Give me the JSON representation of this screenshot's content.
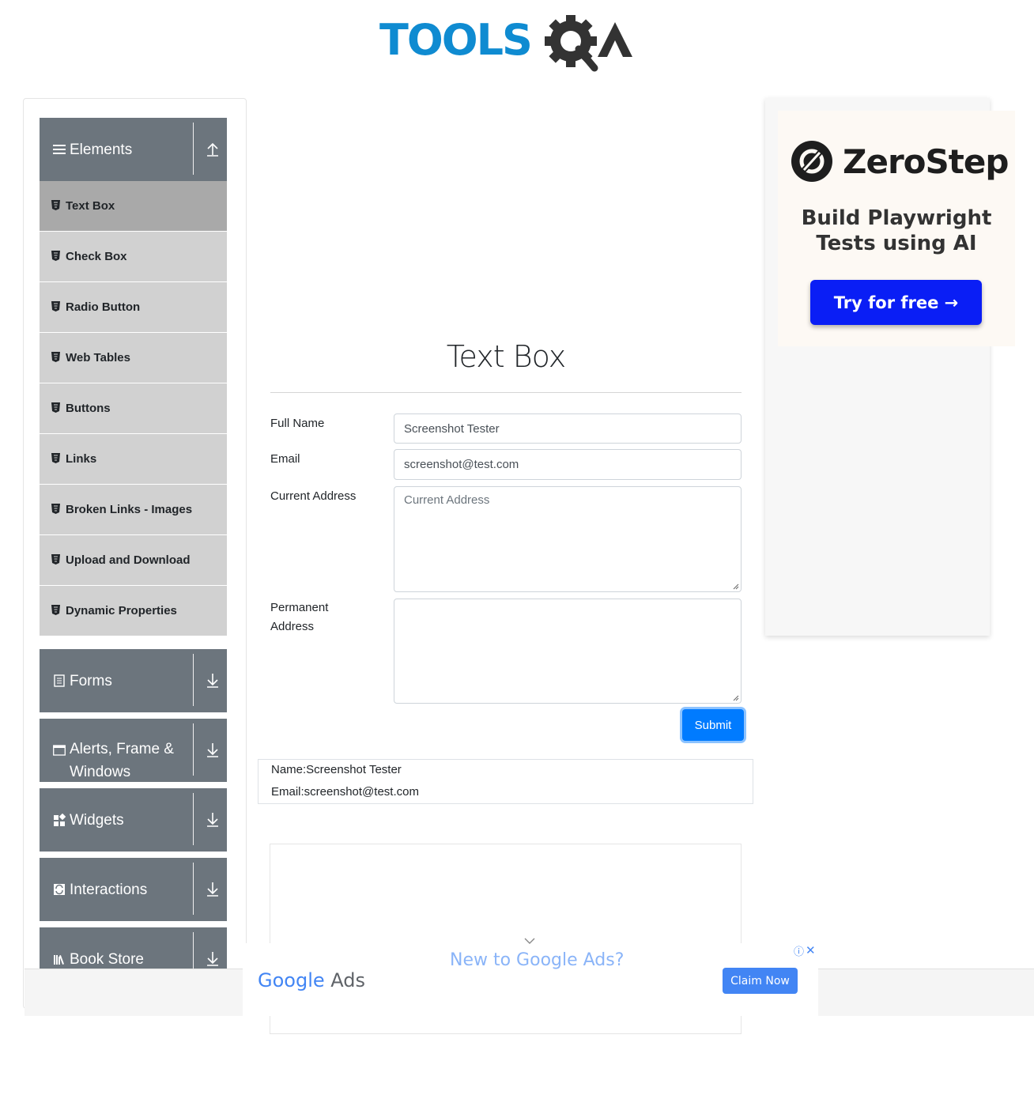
{
  "header": {
    "logo_text": "TOOLSQA"
  },
  "sidebar": {
    "groups": [
      {
        "label": "Elements",
        "expanded": true,
        "icon": "hamburger-icon"
      },
      {
        "label": "Forms",
        "expanded": false,
        "icon": "document-icon"
      },
      {
        "label": "Alerts, Frame & Windows",
        "expanded": false,
        "icon": "window-icon"
      },
      {
        "label": "Widgets",
        "expanded": false,
        "icon": "widgets-icon"
      },
      {
        "label": "Interactions",
        "expanded": false,
        "icon": "interactions-icon"
      },
      {
        "label": "Book Store",
        "expanded": false,
        "icon": "library-icon"
      }
    ],
    "items": [
      {
        "label": "Text Box",
        "active": true
      },
      {
        "label": "Check Box"
      },
      {
        "label": "Radio Button"
      },
      {
        "label": "Web Tables"
      },
      {
        "label": "Buttons"
      },
      {
        "label": "Links"
      },
      {
        "label": "Broken Links - Images"
      },
      {
        "label": "Upload and Download"
      },
      {
        "label": "Dynamic Properties"
      }
    ]
  },
  "main": {
    "title": "Text Box",
    "form": {
      "full_name_label": "Full Name",
      "full_name_value": "Screenshot Tester",
      "email_label": "Email",
      "email_value": "screenshot@test.com",
      "current_address_label": "Current Address",
      "current_address_placeholder": "Current Address",
      "permanent_address_label_1": "Permanent",
      "permanent_address_label_2": "Address",
      "submit_label": "Submit"
    },
    "output": {
      "name_line": "Name:Screenshot Tester",
      "email_line": "Email:screenshot@test.com"
    }
  },
  "right_ad": {
    "brand": "ZeroStep",
    "tagline_1": "Build Playwright",
    "tagline_2": "Tests using AI",
    "cta": "Try for free →"
  },
  "bottom_ad": {
    "logo_google": "Google",
    "logo_ads": "Ads",
    "headline": "New to Google Ads?",
    "cta": "Claim Now",
    "info_symbol": "ⓘ",
    "close_symbol": "✕"
  },
  "colors": {
    "brand_blue": "#0f8bd1",
    "logo_gray": "#333333",
    "sidebar_header": "#6c757d",
    "menu_item": "#d1d1d1",
    "menu_item_active": "#a9a9a9",
    "primary": "#007bff",
    "zerostep_cta": "#0a1ef5"
  }
}
